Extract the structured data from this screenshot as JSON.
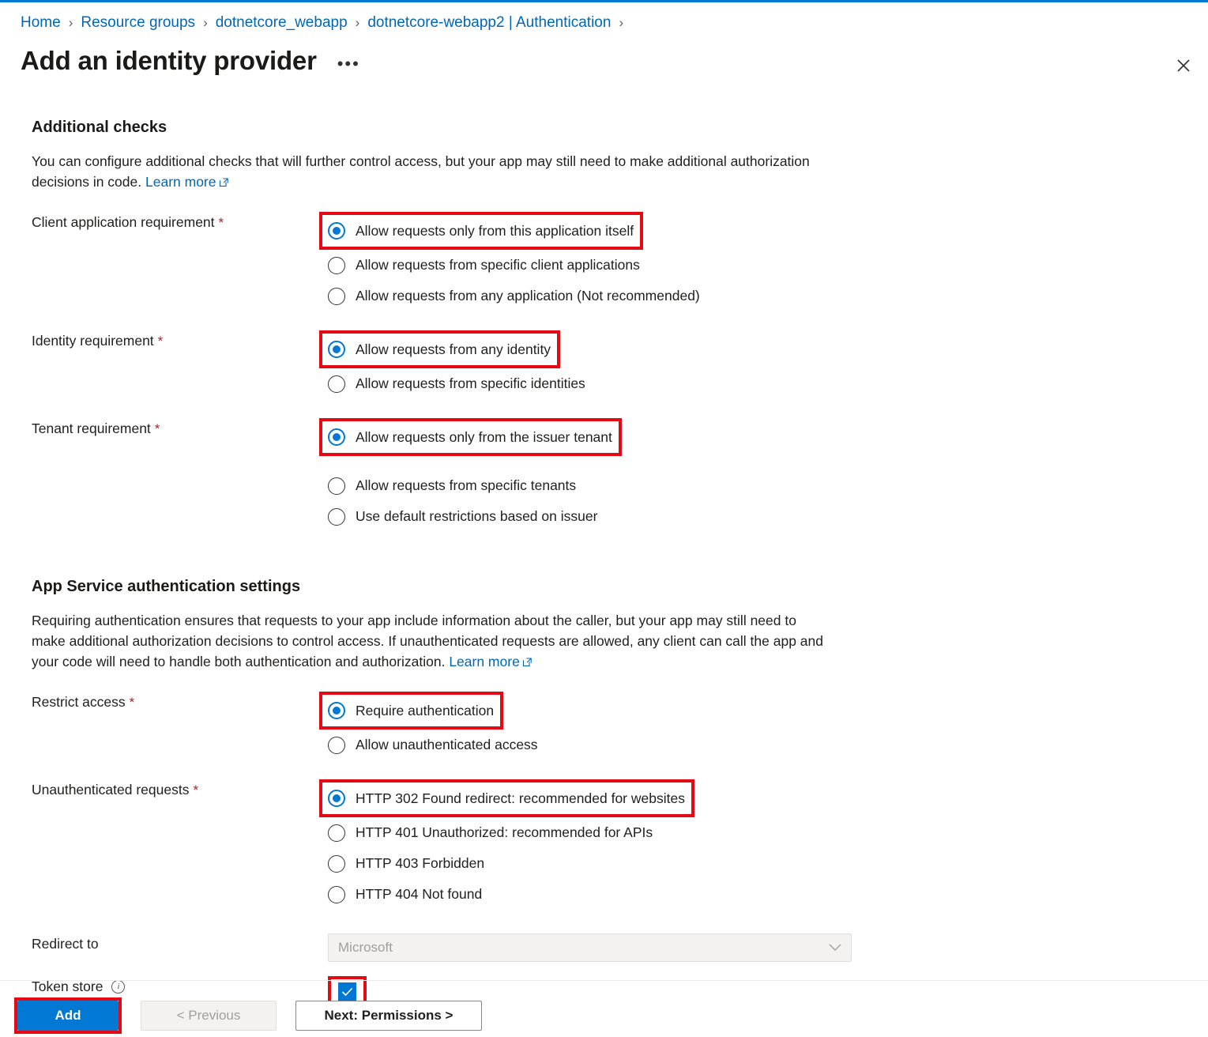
{
  "theme": {
    "accent": "#0078d4",
    "link": "#0067b8",
    "annotation_red": "#e50914",
    "required_star": "#a4262c",
    "disabled_text": "#a19f9d"
  },
  "breadcrumb": {
    "items": [
      {
        "label": "Home"
      },
      {
        "label": "Resource groups"
      },
      {
        "label": "dotnetcore_webapp"
      },
      {
        "label": "dotnetcore-webapp2 | Authentication"
      }
    ],
    "separator": "›"
  },
  "header": {
    "title": "Add an identity provider",
    "more_label": "•••",
    "close_label": "Close"
  },
  "additional_checks": {
    "heading": "Additional checks",
    "description_part1": "You can configure additional checks that will further control access, but your app may still need to make additional authorization decisions in code.",
    "learn_more": "Learn more",
    "fields": [
      {
        "label": "Client application requirement",
        "required": true,
        "options": [
          {
            "text": "Allow requests only from this application itself",
            "selected": true,
            "highlighted": true
          },
          {
            "text": "Allow requests from specific client applications",
            "selected": false,
            "highlighted": false
          },
          {
            "text": "Allow requests from any application (Not recommended)",
            "selected": false,
            "highlighted": false
          }
        ]
      },
      {
        "label": "Identity requirement",
        "required": true,
        "options": [
          {
            "text": "Allow requests from any identity",
            "selected": true,
            "highlighted": true
          },
          {
            "text": "Allow requests from specific identities",
            "selected": false,
            "highlighted": false
          }
        ]
      },
      {
        "label": "Tenant requirement",
        "required": true,
        "options": [
          {
            "text": "Allow requests only from the issuer tenant",
            "selected": true,
            "highlighted": true
          },
          {
            "text": "Allow requests from specific tenants",
            "selected": false,
            "highlighted": false
          },
          {
            "text": "Use default restrictions based on issuer",
            "selected": false,
            "highlighted": false
          }
        ]
      }
    ]
  },
  "auth_settings": {
    "heading": "App Service authentication settings",
    "description_part1": "Requiring authentication ensures that requests to your app include information about the caller, but your app may still need to make additional authorization decisions to control access. If unauthenticated requests are allowed, any client can call the app and your code will need to handle both authentication and authorization.",
    "learn_more": "Learn more",
    "restrict_access": {
      "label": "Restrict access",
      "required": true,
      "options": [
        {
          "text": "Require authentication",
          "selected": true,
          "highlighted": true
        },
        {
          "text": "Allow unauthenticated access",
          "selected": false,
          "highlighted": false
        }
      ]
    },
    "unauthenticated_requests": {
      "label": "Unauthenticated requests",
      "required": true,
      "options": [
        {
          "text": "HTTP 302 Found redirect: recommended for websites",
          "selected": true,
          "highlighted": true
        },
        {
          "text": "HTTP 401 Unauthorized: recommended for APIs",
          "selected": false,
          "highlighted": false
        },
        {
          "text": "HTTP 403 Forbidden",
          "selected": false,
          "highlighted": false
        },
        {
          "text": "HTTP 404 Not found",
          "selected": false,
          "highlighted": false
        }
      ]
    },
    "redirect_to": {
      "label": "Redirect to",
      "value": "Microsoft",
      "disabled": true
    },
    "token_store": {
      "label": "Token store",
      "checked": true,
      "highlighted": true,
      "has_info": true
    }
  },
  "footer": {
    "add_label": "Add",
    "previous_label": "< Previous",
    "next_label": "Next: Permissions >"
  }
}
